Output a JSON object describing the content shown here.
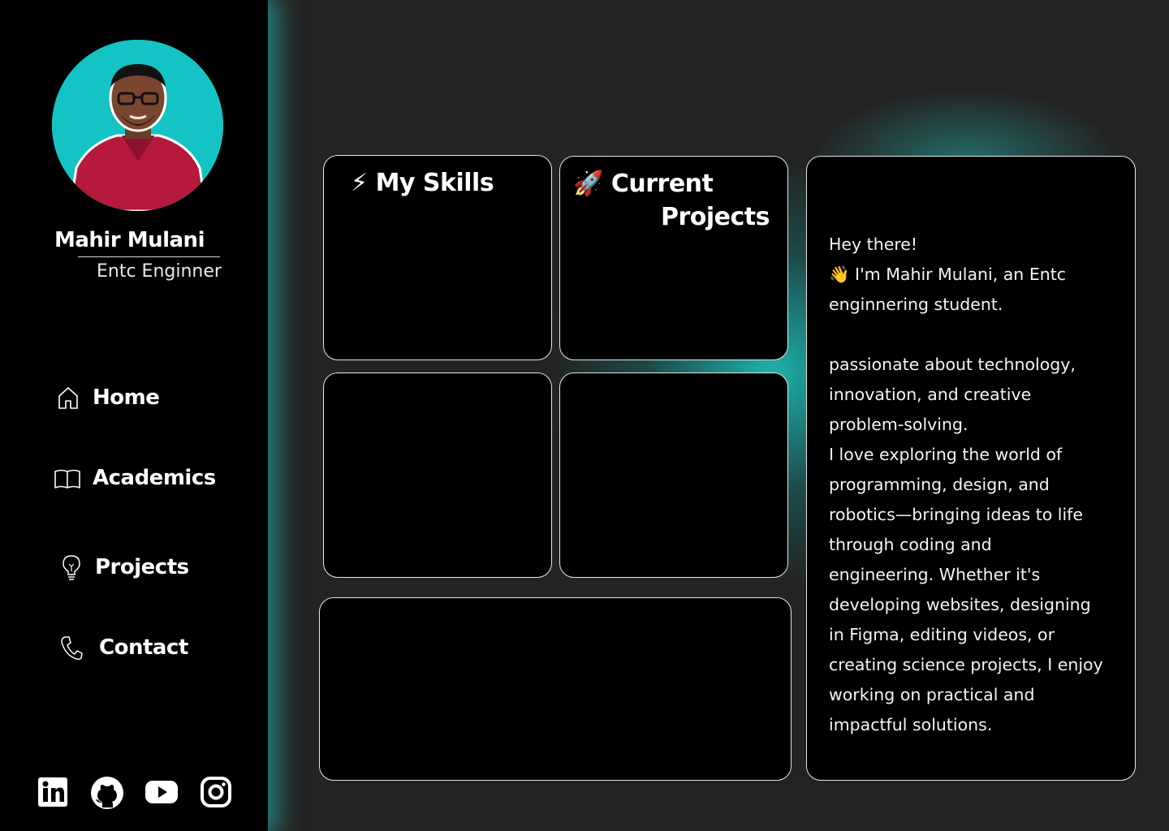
{
  "profile": {
    "name": "Mahir Mulani",
    "role": "Entc Enginner"
  },
  "nav": [
    {
      "label": "Home",
      "icon": "home-icon"
    },
    {
      "label": "Academics",
      "icon": "book-icon"
    },
    {
      "label": "Projects",
      "icon": "bulb-icon"
    },
    {
      "label": "Contact",
      "icon": "phone-icon"
    }
  ],
  "socials": [
    "linkedin-icon",
    "github-icon",
    "youtube-icon",
    "instagram-icon"
  ],
  "cards": {
    "skills": {
      "emoji": "⚡",
      "title": "My Skills"
    },
    "projects": {
      "emoji": "🚀",
      "title_line1": "Current",
      "title_line2": "Projects"
    }
  },
  "about": {
    "text": "Hey there!\n👋 I'm Mahir Mulani, an Entc\nenginnering student.\n\npassionate about technology,\ninnovation, and creative\nproblem-solving.\nI love exploring the world of\nprogramming, design, and\nrobotics—bringing ideas to life\nthrough coding and\nengineering. Whether it's\ndeveloping websites, designing\nin Figma, editing videos, or\ncreating science projects, I enjoy\nworking on practical and\nimpactful solutions."
  },
  "colors": {
    "accent": "#14c4c4",
    "background": "#232323",
    "sidebar": "#000000",
    "shirt": "#b5193c"
  }
}
